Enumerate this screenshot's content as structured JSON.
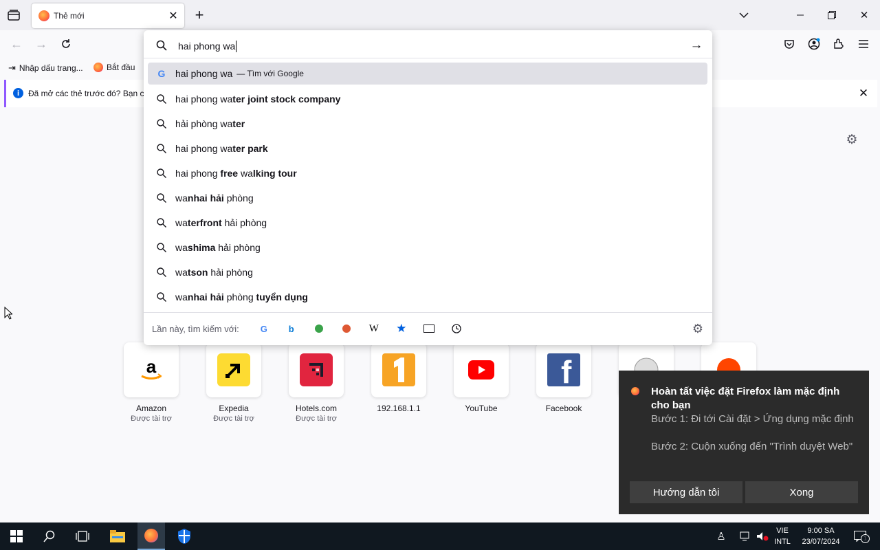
{
  "tab": {
    "title": "Thẻ mới"
  },
  "bookmarks": {
    "import_label": "Nhập dấu trang...",
    "start_label": "Bắt đầu"
  },
  "infobar": {
    "text": "Đã mở các thẻ trước đó? Bạn có"
  },
  "urlbar": {
    "value": "hai phong wa",
    "suggestions": [
      {
        "prefix": "hai phong wa",
        "bold": "",
        "tail": "",
        "suffix": " — Tìm với Google",
        "engine": "google"
      },
      {
        "prefix": "hai phong wa",
        "bold": "ter joint stock company",
        "tail": ""
      },
      {
        "prefix": "hải phòng wa",
        "bold": "ter",
        "tail": ""
      },
      {
        "prefix": "hai phong wa",
        "bold": "ter park",
        "tail": ""
      },
      {
        "prefix": "hai phong ",
        "bold": "free",
        "tail": " wa",
        "bold2": "lking tour"
      },
      {
        "prefix": "wa",
        "bold": "nhai hải",
        "tail": " phòng"
      },
      {
        "prefix": "wa",
        "bold": "terfront",
        "tail": " hải phòng"
      },
      {
        "prefix": "wa",
        "bold": "shima",
        "tail": " hải phòng"
      },
      {
        "prefix": "wa",
        "bold": "tson",
        "tail": " hải phòng"
      },
      {
        "prefix": "wa",
        "bold": "nhai hải",
        "tail": " phòng ",
        "bold2": "tuyển dụng"
      }
    ],
    "search_with_label": "Lần này, tìm kiếm với:"
  },
  "top_sites": [
    {
      "name": "Amazon",
      "sub": "Được tài trợ",
      "icon": "amazon-icon"
    },
    {
      "name": "Expedia",
      "sub": "Được tài trợ",
      "icon": "expedia-icon"
    },
    {
      "name": "Hotels.com",
      "sub": "Được tài trợ",
      "icon": "hotels-icon"
    },
    {
      "name": "192.168.1.1",
      "sub": "",
      "icon": "number-one-icon"
    },
    {
      "name": "YouTube",
      "sub": "",
      "icon": "youtube-icon"
    },
    {
      "name": "Facebook",
      "sub": "",
      "icon": "facebook-icon"
    }
  ],
  "toast": {
    "title": "Hoàn tất việc đặt Firefox làm mặc định cho bạn",
    "step1": "Bước 1: Đi tới Cài đặt > Ứng dụng mặc định",
    "step2": "Bước 2: Cuộn xuống đến \"Trình duyệt Web\"",
    "guide_button": "Hướng dẫn tôi",
    "done_button": "Xong"
  },
  "taskbar": {
    "lang1": "VIE",
    "lang2": "INTL",
    "time": "9:00 SA",
    "date": "23/07/2024",
    "notif_count": "1"
  },
  "colors": {
    "accent": "#9059ff",
    "info_blue": "#0060df",
    "toast_bg": "#2b2b2b"
  }
}
